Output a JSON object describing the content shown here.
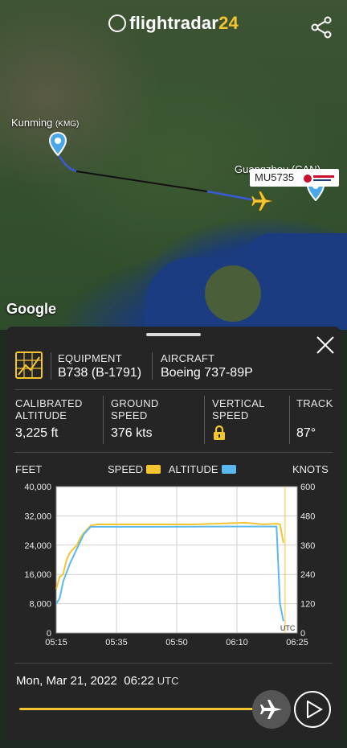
{
  "app": {
    "brand_main": "flightradar",
    "brand_num": "24"
  },
  "map": {
    "origin_label": "Kunming",
    "origin_code": "(KMG)",
    "destination_label_partial": "Guangzhou (CAN)",
    "flight_callout": "MU5735",
    "watermark": "Google",
    "colors": {
      "route_blue": "#3a5bd9",
      "route_dark": "#111111",
      "plane_yellow": "#f4c531",
      "pin": "#4aa8e8"
    }
  },
  "panel": {
    "equipment_label": "EQUIPMENT",
    "equipment_value": "B738 (B-1791)",
    "aircraft_label": "AIRCRAFT",
    "aircraft_value": "Boeing 737-89P",
    "stats": [
      {
        "label1": "CALIBRATED",
        "label2": "ALTITUDE",
        "value": "3,225 ft"
      },
      {
        "label1": "GROUND",
        "label2": "SPEED",
        "value": "376 kts"
      },
      {
        "label1": "VERTICAL",
        "label2": "SPEED",
        "value": ""
      },
      {
        "label1": "TRACK",
        "label2": "",
        "value": "87°"
      }
    ],
    "vertical_speed_locked": true
  },
  "chart_data": {
    "type": "line",
    "left_axis_label": "FEET",
    "right_axis_label": "KNOTS",
    "legend": [
      {
        "name": "SPEED",
        "color": "#f4c531"
      },
      {
        "name": "ALTITUDE",
        "color": "#5ab8ee"
      }
    ],
    "x_ticks": [
      "05:15",
      "05:35",
      "05:50",
      "06:10",
      "06:25"
    ],
    "y_left_ticks": [
      "40,000",
      "32,000",
      "24,000",
      "16,000",
      "8,000",
      "0"
    ],
    "y_right_ticks": [
      "600",
      "480",
      "360",
      "240",
      "120",
      "0"
    ],
    "y_left_range": [
      0,
      40000
    ],
    "y_right_range": [
      0,
      600
    ],
    "x_range_minutes": [
      0,
      70
    ],
    "grid": true,
    "cursor_label": "UTC",
    "series": [
      {
        "name": "SPEED",
        "axis": "right",
        "x": [
          0,
          1,
          2,
          3,
          4,
          5,
          6,
          7,
          8,
          10,
          12,
          14,
          20,
          40,
          55,
          60,
          64,
          65,
          66
        ],
        "y": [
          180,
          230,
          240,
          300,
          330,
          345,
          360,
          390,
          410,
          440,
          445,
          445,
          445,
          445,
          452,
          445,
          448,
          445,
          370
        ]
      },
      {
        "name": "ALTITUDE",
        "axis": "left",
        "x": [
          0,
          1,
          2,
          4,
          6,
          8,
          10,
          12,
          14,
          30,
          50,
          64,
          65,
          66
        ],
        "y": [
          8000,
          9500,
          14000,
          19000,
          23000,
          27000,
          29000,
          29000,
          29000,
          29000,
          29100,
          29100,
          8000,
          3225
        ]
      }
    ]
  },
  "playback": {
    "date": "Mon, Mar 21, 2022",
    "time": "06:22",
    "tz": "UTC",
    "progress": 0.95
  }
}
